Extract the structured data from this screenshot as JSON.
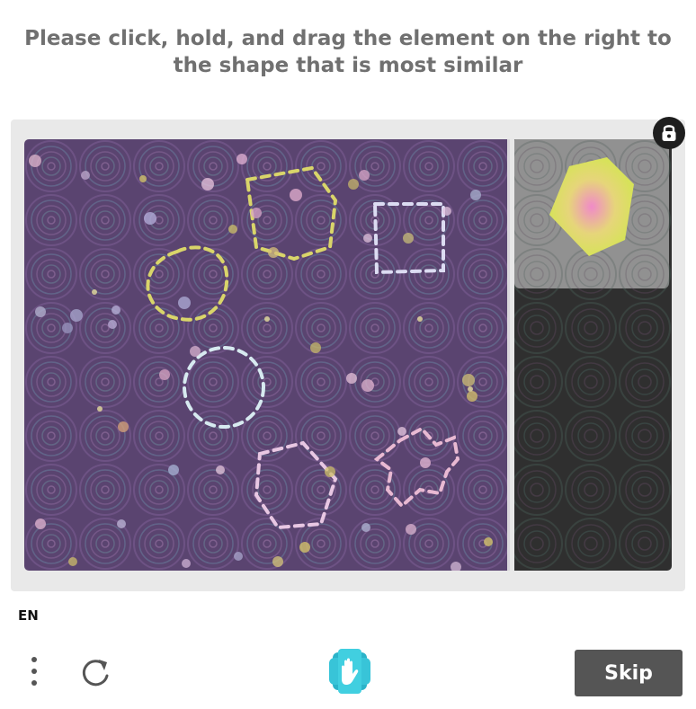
{
  "prompt": {
    "text": "Please click, hold, and drag the element on the right to the shape that is most similar"
  },
  "language": {
    "label": "EN"
  },
  "footer": {
    "skip_label": "Skip"
  },
  "icons": {
    "lock": "lock-icon",
    "menu": "vertical-dots-icon",
    "refresh": "refresh-icon",
    "logo": "hand-logo-icon"
  },
  "colors": {
    "board_background": "#5a4470",
    "right_column": "#2f2f2f",
    "drag_shape_fill": "#dbe25a",
    "skip_button": "#555555",
    "prompt_text": "#707070"
  }
}
